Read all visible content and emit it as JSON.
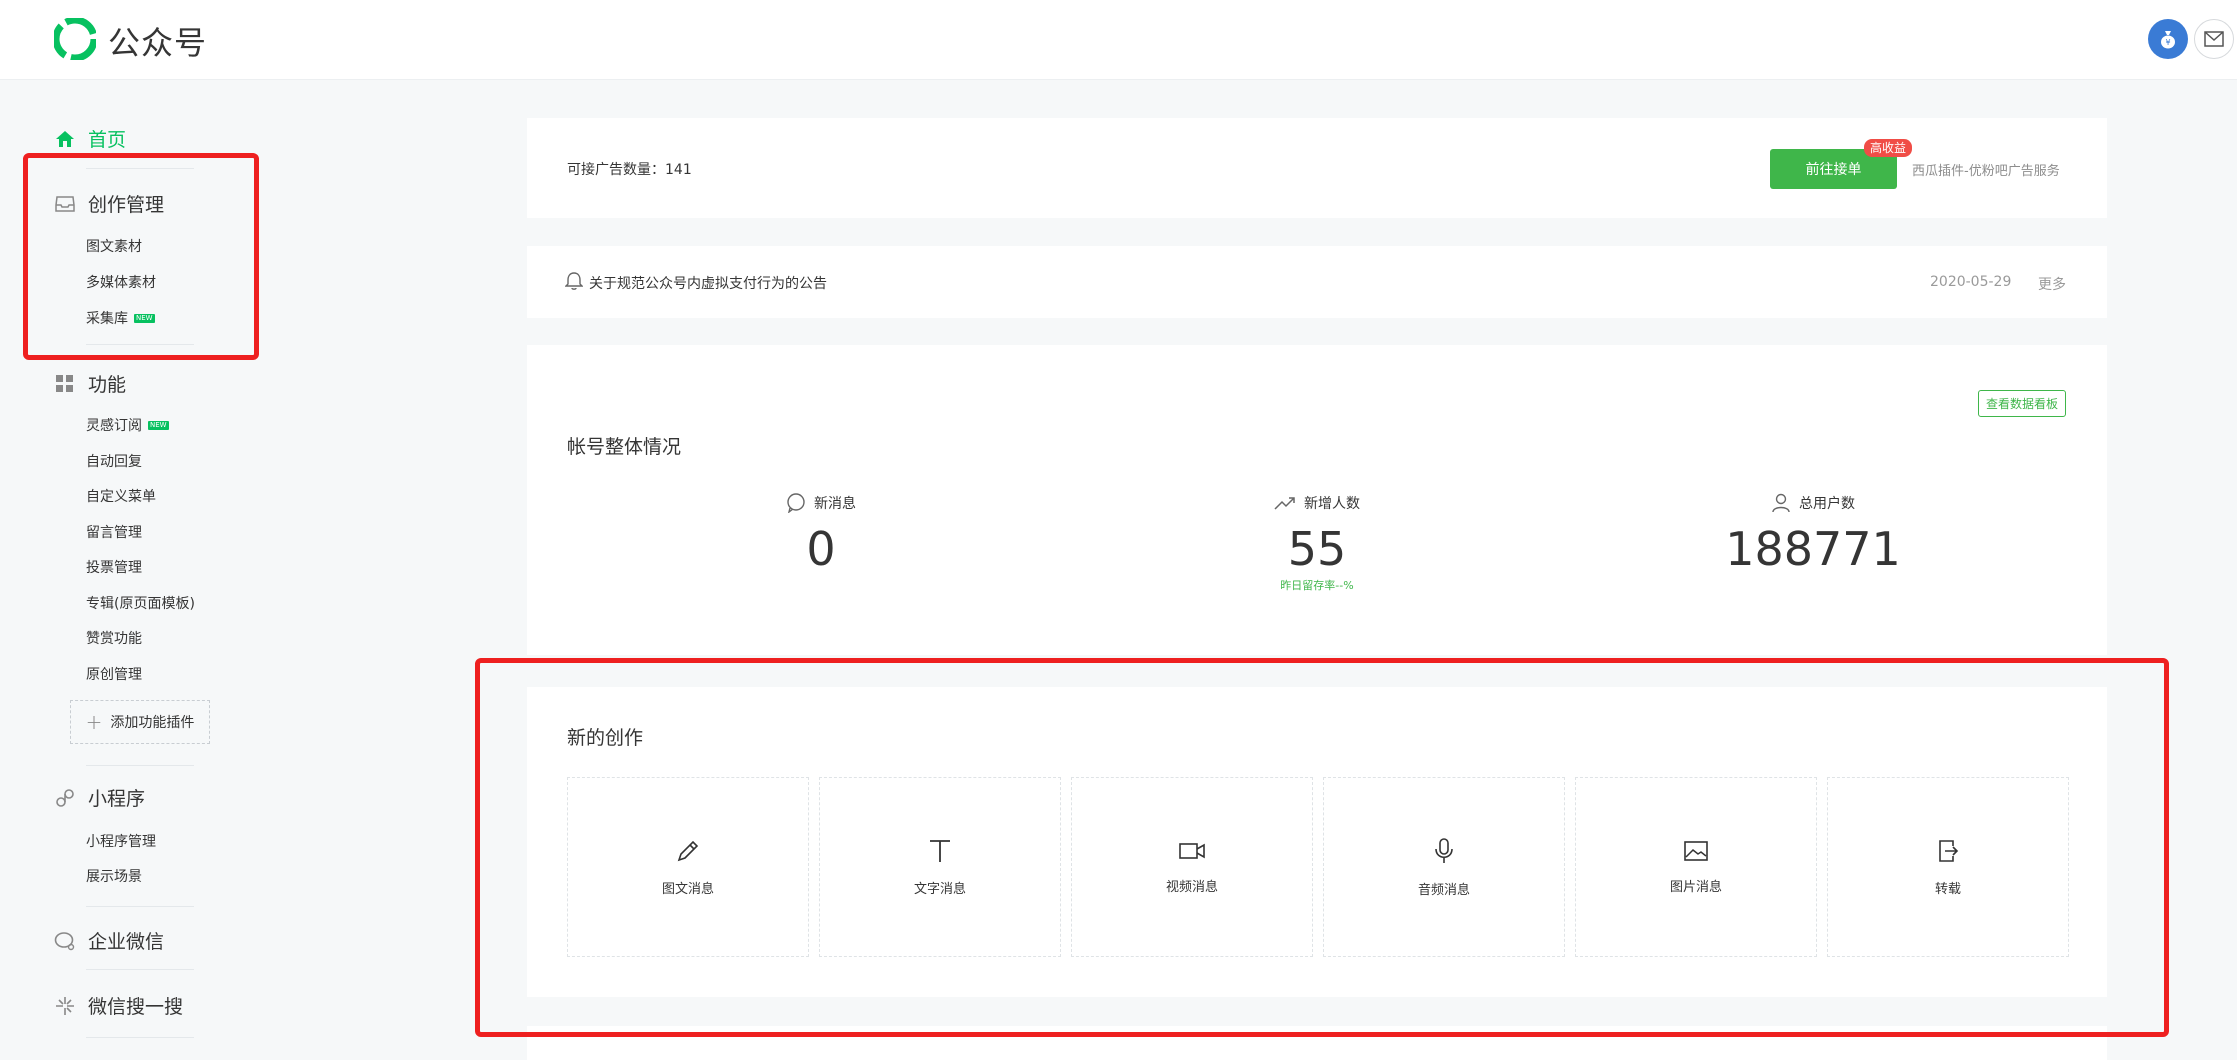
{
  "header": {
    "app_title": "公众号",
    "brand_color": "#07c160"
  },
  "sidebar": {
    "home": "首页",
    "creation": {
      "title": "创作管理",
      "items": [
        "图文素材",
        "多媒体素材",
        "采集库"
      ]
    },
    "features": {
      "title": "功能",
      "items": [
        "灵感订阅",
        "自动回复",
        "自定义菜单",
        "留言管理",
        "投票管理",
        "专辑(原页面模板)",
        "赞赏功能",
        "原创管理"
      ],
      "add_plugin": "添加功能插件"
    },
    "miniprogram": {
      "title": "小程序",
      "items": [
        "小程序管理",
        "展示场景"
      ]
    },
    "wecom": "企业微信",
    "search": "微信搜一搜",
    "new_badge": "NEW"
  },
  "ads": {
    "count_label": "可接广告数量：141",
    "go_button": "前往接单",
    "hot_badge": "高收益",
    "service": "西瓜插件-优粉吧广告服务"
  },
  "notice": {
    "text": "关于规范公众号内虚拟支付行为的公告",
    "date": "2020-05-29",
    "more": "更多"
  },
  "overview": {
    "view_board": "查看数据看板",
    "title": "帐号整体情况",
    "stats": [
      {
        "label": "新消息",
        "value": "0",
        "note": ""
      },
      {
        "label": "新增人数",
        "value": "55",
        "note": "昨日留存率--%"
      },
      {
        "label": "总用户数",
        "value": "188771",
        "note": ""
      }
    ]
  },
  "create": {
    "title": "新的创作",
    "tiles": [
      {
        "label": "图文消息",
        "icon": "pencil-icon"
      },
      {
        "label": "文字消息",
        "icon": "text-icon"
      },
      {
        "label": "视频消息",
        "icon": "video-icon"
      },
      {
        "label": "音频消息",
        "icon": "microphone-icon"
      },
      {
        "label": "图片消息",
        "icon": "image-icon"
      },
      {
        "label": "转载",
        "icon": "repost-icon"
      }
    ]
  }
}
